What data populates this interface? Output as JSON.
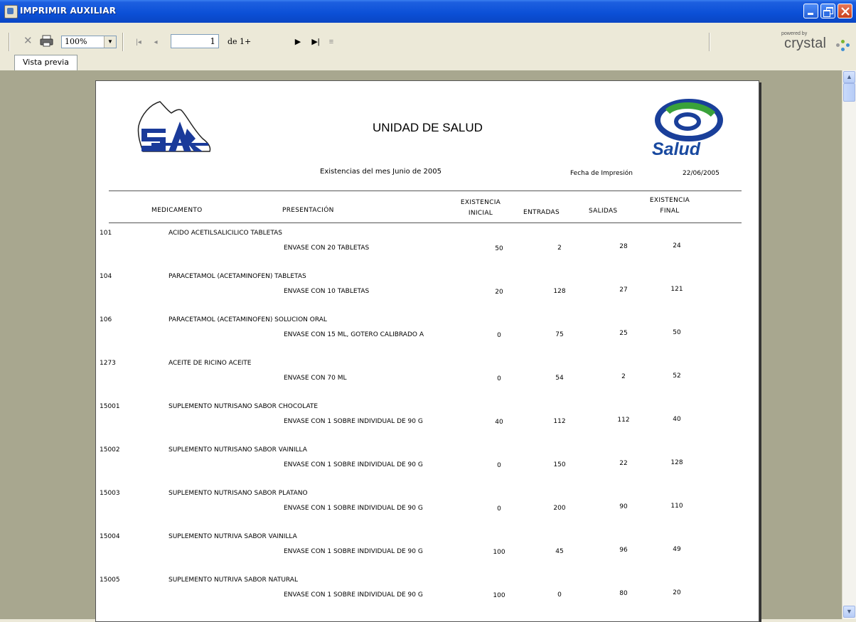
{
  "window": {
    "title": "IMPRIMIR AUXILIAR"
  },
  "toolbar": {
    "zoom": "100%",
    "current_page": "1",
    "page_count": "de 1+",
    "powered_by": "powered by",
    "brand": "crystal"
  },
  "tab": {
    "label": "Vista previa"
  },
  "report": {
    "title": "UNIDAD DE SALUD",
    "subtitle": "Existencias  del  mes  Junio de 2005",
    "date_label": "Fecha de Impresión",
    "date_value": "22/06/2005",
    "salud_logo_text": "Salud",
    "headers": {
      "medicamento": "MEDICAMENTO",
      "presentacion": "PRESENTACIÓN",
      "existencia_inicial_1": "EXISTENCIA",
      "existencia_inicial_2": "INICIAL",
      "entradas": "ENTRADAS",
      "salidas": "SALIDAS",
      "existencia_final_1": "EXISTENCIA",
      "existencia_final_2": "FINAL"
    },
    "rows": [
      {
        "code": "101",
        "name": "ACIDO ACETILSALICILICO TABLETAS",
        "presentation": "ENVASE CON 20 TABLETAS",
        "inicial": "50",
        "entradas": "2",
        "salidas": "28",
        "final": "24"
      },
      {
        "code": "104",
        "name": "PARACETAMOL (ACETAMINOFEN) TABLETAS",
        "presentation": "ENVASE CON 10 TABLETAS",
        "inicial": "20",
        "entradas": "128",
        "salidas": "27",
        "final": "121"
      },
      {
        "code": "106",
        "name": "PARACETAMOL (ACETAMINOFEN) SOLUCION ORAL",
        "presentation": "ENVASE CON 15 ML, GOTERO CALIBRADO A",
        "inicial": "0",
        "entradas": "75",
        "salidas": "25",
        "final": "50"
      },
      {
        "code": "1273",
        "name": "ACEITE DE RICINO ACEITE",
        "presentation": "ENVASE CON 70 ML",
        "inicial": "0",
        "entradas": "54",
        "salidas": "2",
        "final": "52"
      },
      {
        "code": "15001",
        "name": "SUPLEMENTO NUTRISANO SABOR CHOCOLATE",
        "presentation": "ENVASE CON 1 SOBRE INDIVIDUAL DE 90 G",
        "inicial": "40",
        "entradas": "112",
        "salidas": "112",
        "final": "40"
      },
      {
        "code": "15002",
        "name": "SUPLEMENTO NUTRISANO SABOR VAINILLA",
        "presentation": "ENVASE CON 1 SOBRE INDIVIDUAL DE 90 G",
        "inicial": "0",
        "entradas": "150",
        "salidas": "22",
        "final": "128"
      },
      {
        "code": "15003",
        "name": "SUPLEMENTO NUTRISANO SABOR PLATANO",
        "presentation": "ENVASE CON 1 SOBRE INDIVIDUAL DE 90 G",
        "inicial": "0",
        "entradas": "200",
        "salidas": "90",
        "final": "110"
      },
      {
        "code": "15004",
        "name": "SUPLEMENTO NUTRIVA SABOR VAINILLA",
        "presentation": "ENVASE CON 1 SOBRE INDIVIDUAL DE 90 G",
        "inicial": "100",
        "entradas": "45",
        "salidas": "96",
        "final": "49"
      },
      {
        "code": "15005",
        "name": "SUPLEMENTO NUTRIVA SABOR NATURAL",
        "presentation": "ENVASE CON 1 SOBRE INDIVIDUAL DE 90 G",
        "inicial": "100",
        "entradas": "0",
        "salidas": "80",
        "final": "20"
      }
    ]
  },
  "colors": {
    "titlebar": "#0b4fd6",
    "viewer_bg": "#a8a78f",
    "salud_blue": "#1a4aa0",
    "salud_green": "#3aa23a"
  }
}
